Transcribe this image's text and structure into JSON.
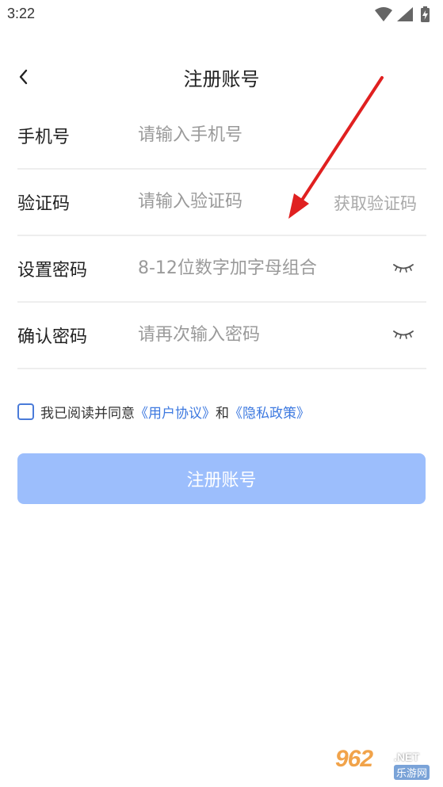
{
  "status_bar": {
    "time": "3:22",
    "icons": [
      "wifi-icon",
      "signal-icon",
      "battery-charging-icon"
    ]
  },
  "header": {
    "title": "注册账号",
    "back_icon": "chevron-left-icon"
  },
  "form": {
    "phone": {
      "label": "手机号",
      "placeholder": "请输入手机号",
      "value": ""
    },
    "code": {
      "label": "验证码",
      "placeholder": "请输入验证码",
      "value": "",
      "get_code_label": "获取验证码"
    },
    "password": {
      "label": "设置密码",
      "placeholder": "8-12位数字加字母组合",
      "value": "",
      "toggle_icon": "eye-closed-icon"
    },
    "confirm_password": {
      "label": "确认密码",
      "placeholder": "请再次输入密码",
      "value": "",
      "toggle_icon": "eye-closed-icon"
    }
  },
  "agreement": {
    "checked": false,
    "prefix": "我已阅读并同意",
    "user_agreement": "《用户协议》",
    "conjunction": "和",
    "privacy_policy": "《隐私政策》"
  },
  "submit": {
    "label": "注册账号"
  },
  "colors": {
    "link": "#3d79e0",
    "button_disabled": "#9cbefc",
    "annotation_arrow": "#e02020",
    "divider": "#eeeeee"
  },
  "watermark": {
    "logo": "962",
    "domain": ".NET",
    "site": "乐游网"
  }
}
